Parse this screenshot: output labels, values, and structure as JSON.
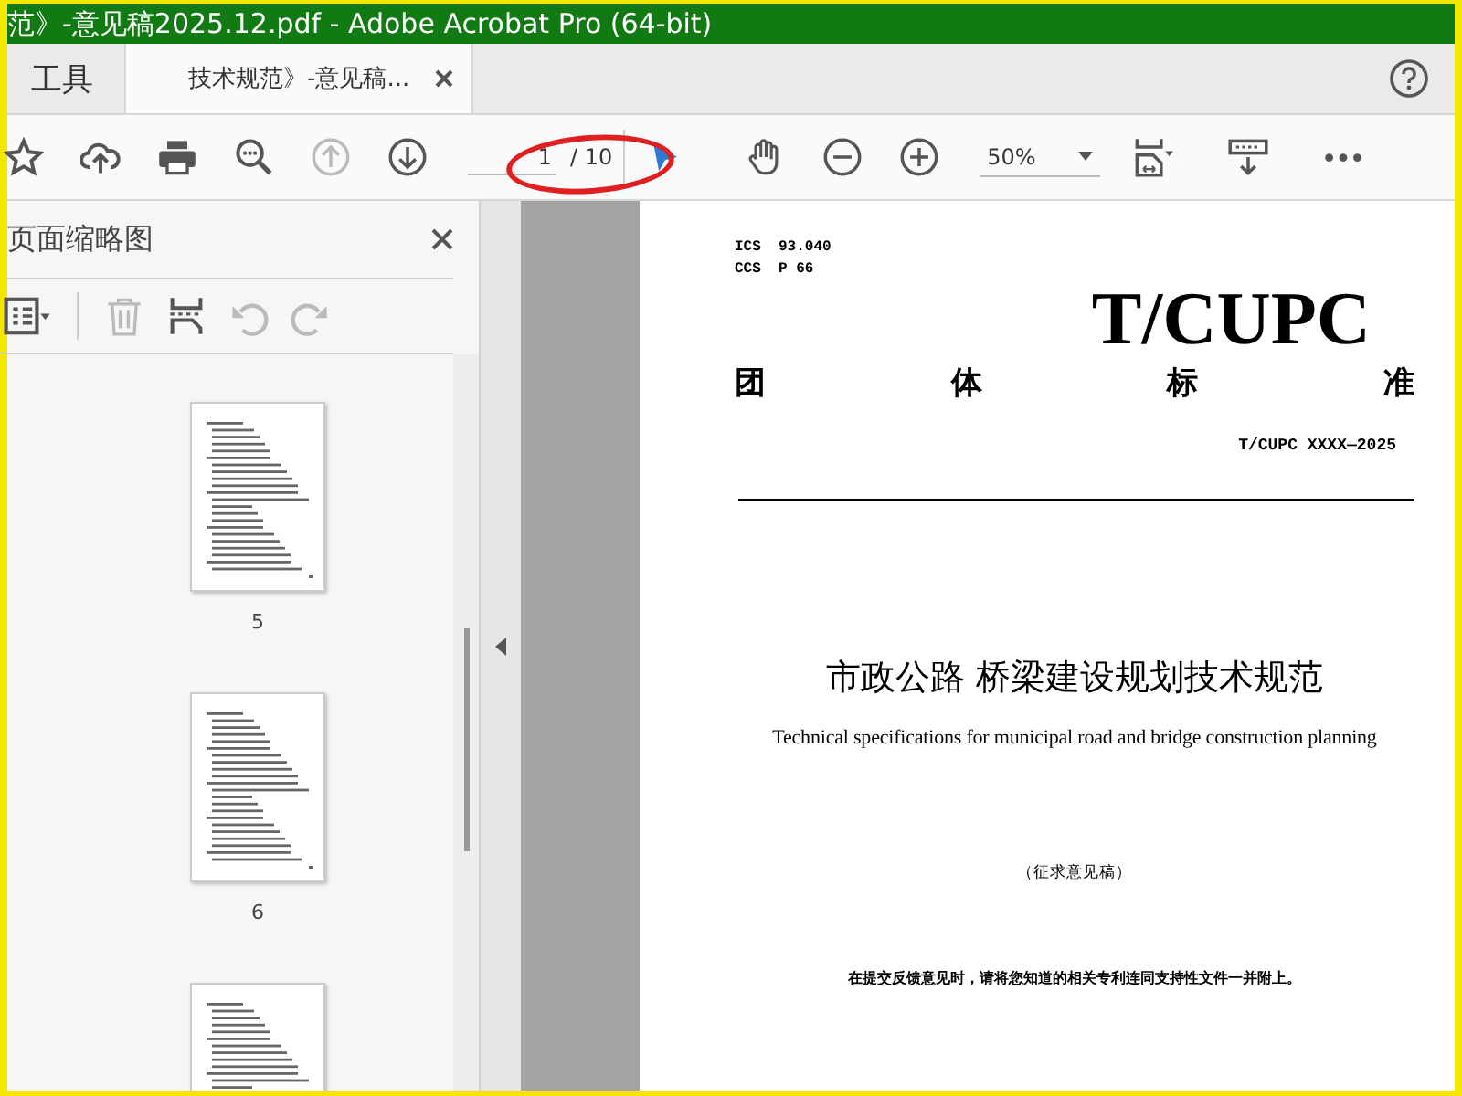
{
  "window": {
    "title": "范》-意见稿2025.12.pdf - Adobe Acrobat Pro (64-bit)"
  },
  "tabs": [
    {
      "label": "工具",
      "kind": "home",
      "selected": false
    },
    {
      "label": "技术规范》-意见稿...",
      "kind": "document",
      "selected": true
    }
  ],
  "toolbar": {
    "tools": [
      {
        "kind": "star",
        "disabled": false
      },
      {
        "kind": "cloud",
        "disabled": false
      },
      {
        "kind": "print",
        "disabled": false
      },
      {
        "kind": "zoom-search",
        "disabled": false
      },
      {
        "kind": "prev",
        "disabled": true
      },
      {
        "kind": "next",
        "disabled": false
      }
    ],
    "page": {
      "value": "1",
      "total": "/ 10"
    },
    "view_tools": [
      {
        "kind": "cursor",
        "disabled": false
      },
      {
        "kind": "hand",
        "disabled": false
      },
      {
        "kind": "zoom-out",
        "disabled": false
      },
      {
        "kind": "zoom-in",
        "disabled": false
      }
    ],
    "zoom": {
      "value": "50%"
    },
    "more_tools": [
      {
        "kind": "fit",
        "disabled": false
      },
      {
        "kind": "read",
        "disabled": false
      },
      {
        "kind": "more",
        "disabled": false
      }
    ]
  },
  "thumbnail_panel": {
    "title": "页面缩略图",
    "tools": [
      {
        "kind": "options",
        "disabled": false
      },
      {
        "kind": "trash",
        "disabled": true
      },
      {
        "kind": "insert",
        "disabled": false
      },
      {
        "kind": "undo",
        "disabled": true
      },
      {
        "kind": "redo",
        "disabled": true
      }
    ],
    "pages": [
      {
        "label": "5",
        "cut_off": false
      },
      {
        "label": "6",
        "cut_off": false
      },
      {
        "cut_off": true
      }
    ]
  },
  "document": {
    "ics": "ICS  93.040",
    "ccs": "CCS  P 66",
    "logo": "T/CUPC",
    "category": [
      "团",
      "体",
      "标",
      "准"
    ],
    "code": "T/CUPC XXXX—2025",
    "title": "市政公路 桥梁建设规划技术规范",
    "english_title": "Technical specifications for municipal road and bridge construction planning",
    "stage": "（征求意见稿）",
    "notice": "在提交反馈意见时，请将您知道的相关专利连同支持性文件一并附上。"
  }
}
